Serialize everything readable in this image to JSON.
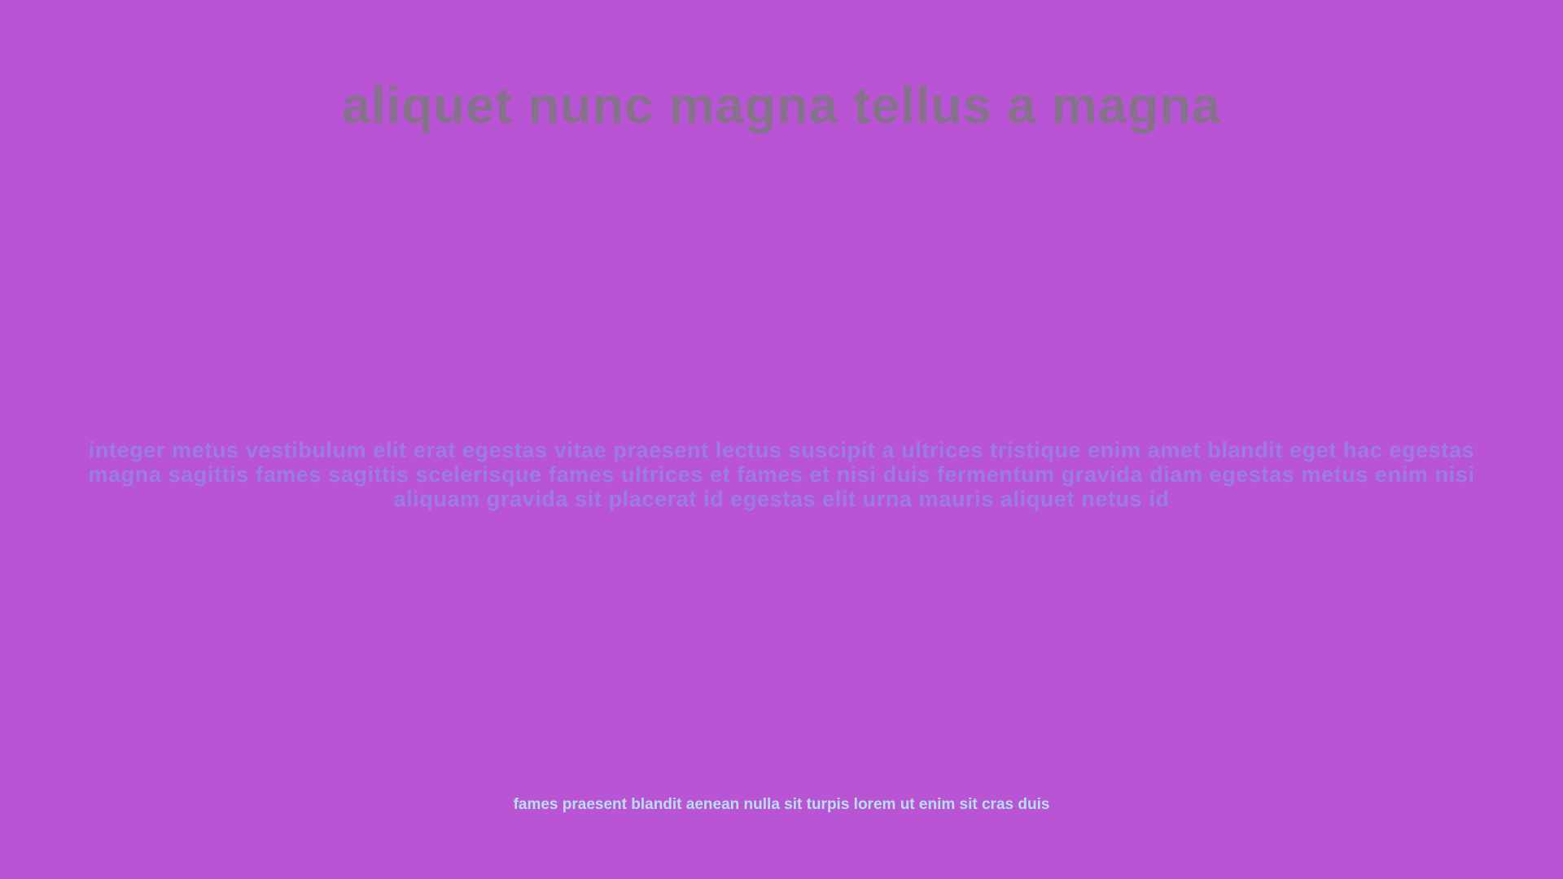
{
  "colors": {
    "background": "#b955d4",
    "headline": "#87728d",
    "body_text": "#9b7be6",
    "footer_text": "#b7dff4"
  },
  "headline": "aliquet nunc magna tellus a magna",
  "body_text": "integer metus vestibulum elit erat egestas vitae praesent lectus suscipit a ultrices tristique enim amet blandit eget hac egestas magna sagittis fames sagittis scelerisque fames ultrices et fames et nisi duis fermentum gravida diam egestas metus enim nisi aliquam gravida sit placerat id egestas elit urna mauris aliquet netus id",
  "footer_text": "fames praesent blandit aenean nulla sit turpis lorem ut enim sit cras duis"
}
